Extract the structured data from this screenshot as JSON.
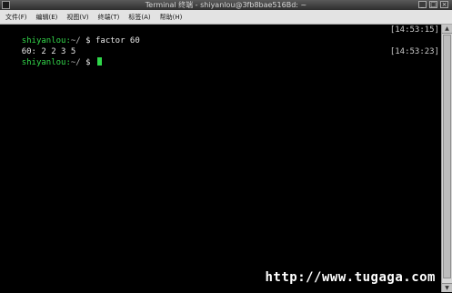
{
  "window": {
    "title": "Terminal 终端 - shiyanlou@3fb8bae516Bd: ~",
    "buttons": [
      "_",
      "□",
      "×"
    ]
  },
  "menu": {
    "items": [
      "文件(F)",
      "编辑(E)",
      "视图(V)",
      "终端(T)",
      "标签(A)",
      "帮助(H)"
    ]
  },
  "terminal": {
    "lines": [
      {
        "user": "shiyanlou:",
        "path": "~/",
        "prompt": " $ ",
        "command": "factor 60",
        "timestamp": "[14:53:15]"
      },
      {
        "output": "60: 2 2 3 5"
      },
      {
        "user": "shiyanlou:",
        "path": "~/",
        "prompt": " $ ",
        "command": "",
        "timestamp": "[14:53:23]"
      }
    ]
  },
  "watermark": "http://www.tugaga.com",
  "colors": {
    "prompt_user": "#33d64a",
    "cursor": "#2fd64a",
    "background": "#000000"
  }
}
